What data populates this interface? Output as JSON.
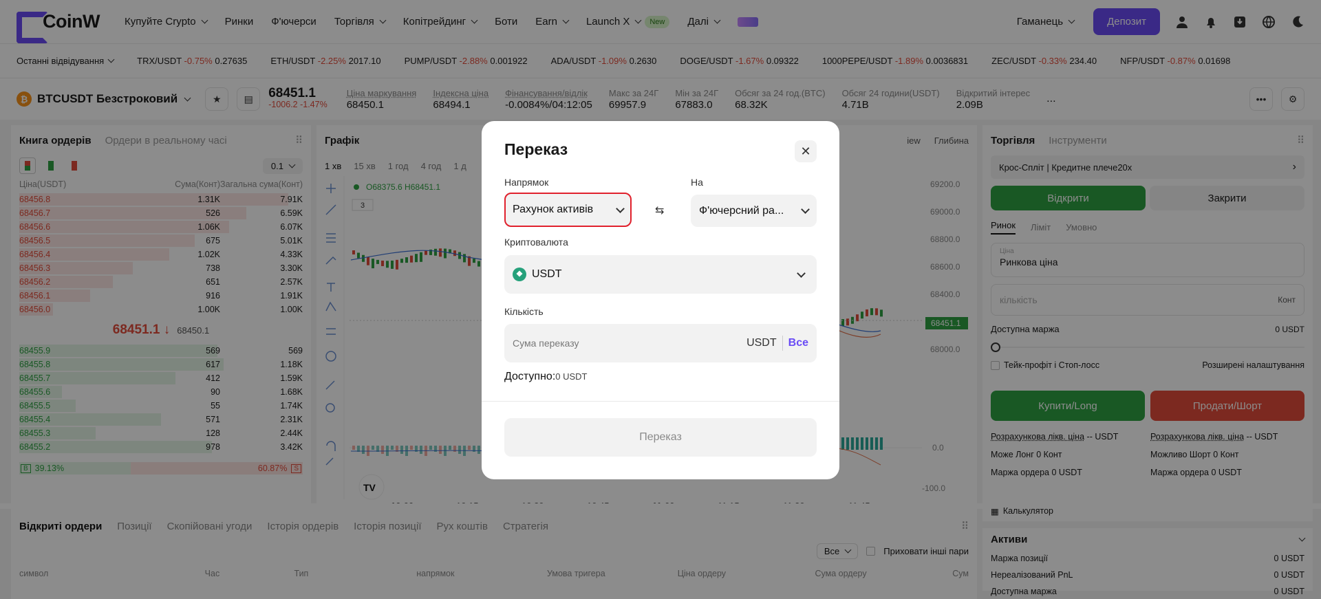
{
  "nav": {
    "logo": "CoinW",
    "items": [
      {
        "label": "Купуйте Crypto",
        "dropdown": true
      },
      {
        "label": "Ринки"
      },
      {
        "label": "Ф'ючерси"
      },
      {
        "label": "Торгівля",
        "dropdown": true
      },
      {
        "label": "Копітрейдинг",
        "dropdown": true
      },
      {
        "label": "Боти"
      },
      {
        "label": "Earn",
        "dropdown": true
      },
      {
        "label": "Launch X",
        "dropdown": true
      }
    ],
    "new_badge": "New",
    "more": "Далі",
    "wallet": "Гаманець",
    "deposit": "Депозит"
  },
  "ticker": {
    "recent": "Останні відвідування",
    "items": [
      {
        "pair": "TRX/USDT",
        "chg": "-0.75%",
        "price": "0.27635"
      },
      {
        "pair": "ETH/USDT",
        "chg": "-2.25%",
        "price": "2017.10"
      },
      {
        "pair": "PUMP/USDT",
        "chg": "-2.88%",
        "price": "0.001922"
      },
      {
        "pair": "ADA/USDT",
        "chg": "-1.09%",
        "price": "0.2630"
      },
      {
        "pair": "DOGE/USDT",
        "chg": "-1.67%",
        "price": "0.09322"
      },
      {
        "pair": "1000PEPE/USDT",
        "chg": "-1.89%",
        "price": "0.0036831"
      },
      {
        "pair": "ZEC/USDT",
        "chg": "-0.33%",
        "price": "234.40"
      },
      {
        "pair": "NFP/USDT",
        "chg": "-0.87%",
        "price": "0.01698"
      }
    ]
  },
  "symbol": {
    "coin": "₿",
    "name": "BTCUSDT Безстроковий",
    "price": "68451.1",
    "change": "-1006.2 -1.47%",
    "stats": [
      {
        "k": "Ціна маркування",
        "v": "68450.1"
      },
      {
        "k": "Індексна ціна",
        "v": "68494.1"
      },
      {
        "k": "Фінансування/відлік",
        "v": "-0.0084%/04:12:05"
      },
      {
        "k": "Макс за 24Г",
        "v": "69957.9"
      },
      {
        "k": "Мін за 24Г",
        "v": "67883.0"
      },
      {
        "k": "Обсяг за 24 год.(BTC)",
        "v": "68.32K"
      },
      {
        "k": "Обсяг 24 години(USDT)",
        "v": "4.71B"
      },
      {
        "k": "Відкритий інтерес",
        "v": "2.09B"
      }
    ],
    "more": "..."
  },
  "orderbook": {
    "tab_active": "Книга ордерів",
    "tab_other": "Ордери в реальному часі",
    "precision": "0.1",
    "cols": [
      "Ціна(USDT)",
      "Сума(Конт)",
      "Загальна сума(Конт)"
    ],
    "asks": [
      [
        "68456.8",
        "1.31K",
        "7.91K",
        0.95
      ],
      [
        "68456.7",
        "526",
        "6.59K",
        0.8
      ],
      [
        "68456.6",
        "1.06K",
        "6.07K",
        0.74
      ],
      [
        "68456.5",
        "675",
        "5.01K",
        0.62
      ],
      [
        "68456.4",
        "1.02K",
        "4.33K",
        0.53
      ],
      [
        "68456.3",
        "738",
        "3.30K",
        0.4
      ],
      [
        "68456.2",
        "651",
        "2.57K",
        0.33
      ],
      [
        "68456.1",
        "916",
        "1.91K",
        0.25
      ],
      [
        "68456.0",
        "1.00K",
        "1.00K",
        0.12
      ]
    ],
    "mid": "68451.1 ↓",
    "mid_sub": "68450.1",
    "bids": [
      [
        "68455.9",
        "569",
        "569",
        0.7
      ],
      [
        "68455.8",
        "617",
        "1.18K",
        0.72
      ],
      [
        "68455.7",
        "412",
        "1.59K",
        0.55
      ],
      [
        "68455.6",
        "90",
        "1.68K",
        0.15
      ],
      [
        "68455.5",
        "55",
        "1.74K",
        0.2
      ],
      [
        "68455.4",
        "571",
        "2.31K",
        0.5
      ],
      [
        "68455.3",
        "128",
        "2.44K",
        0.27
      ],
      [
        "68455.2",
        "978",
        "3.42K",
        0.68
      ]
    ],
    "buy_pct": "39.13%",
    "sell_pct": "60.87%",
    "b": "B",
    "s": "S"
  },
  "chart": {
    "title": "Графік",
    "intervals": [
      "1 хв",
      "15 хв",
      "1 год",
      "4 год",
      "1 д"
    ],
    "view": "iew",
    "depth": "Глибина",
    "ohlc": "O68375.6 H68451.1",
    "collapsed": "3",
    "prices": [
      "69200.0",
      "69000.0",
      "68800.0",
      "68600.0",
      "68400.0",
      "68200.0",
      "68000.0"
    ],
    "last": "68451.1",
    "times": [
      "10:00",
      "10:15",
      "10:30",
      "10:45",
      "11:00",
      "11:15",
      "11:30",
      "11:45"
    ],
    "ind": [
      "0.0",
      "-100.0"
    ]
  },
  "trade": {
    "tab_active": "Торгівля",
    "tab_other": "Інструменти",
    "mode": "Крос-Спліт | Кредитне плече20x",
    "open": "Відкрити",
    "close": "Закрити",
    "types": [
      "Ринок",
      "Ліміт",
      "Умовно"
    ],
    "price_lab": "Ціна",
    "price_val": "Ринкова ціна",
    "qty": "кількість",
    "unit": "Конт",
    "margin": "Доступна маржа",
    "margin_val": "0 USDT",
    "tpsl": "Тейк-профіт і Стоп-лосс",
    "adv": "Розширені налаштування",
    "buy": "Купити/Long",
    "sell": "Продати/Шорт",
    "liq": "Розрахункова лікв. ціна",
    "liq_val": "-- USDT",
    "can_long": "Може Лонг 0 Конт",
    "can_short": "Можливо Шорт 0 Конт",
    "order_margin": "Маржа ордера 0 USDT",
    "calc": "Калькулятор",
    "assets": "Активи",
    "asset_rows": [
      {
        "k": "Маржа позиції",
        "v": "0 USDT"
      },
      {
        "k": "Нереалізований PnL",
        "v": "0 USDT"
      },
      {
        "k": "Доступна маржа",
        "v": "0 USDT"
      }
    ],
    "colors": {
      "buy": "#2ea043",
      "sell": "#e24c3b"
    }
  },
  "orders": {
    "tabs": [
      "Відкриті ордери",
      "Позиції",
      "Скопійовані угоди",
      "Історія ордерів",
      "Історія позиції",
      "Рух коштів",
      "Стратегія"
    ],
    "filter": "Все",
    "hide": "Приховати інші пари",
    "cols": [
      "символ",
      "Час",
      "Тип",
      "напрямок",
      "Умова тригера",
      "Ціна ордеру",
      "Сума ордеру",
      "Сум"
    ]
  },
  "modal": {
    "title": "Переказ",
    "from_label": "Напрямок",
    "from_value": "Рахунок активів",
    "to_label": "На",
    "to_value": "Ф'ючерсний ра...",
    "crypto_label": "Криптовалюта",
    "crypto_value": "USDT",
    "amount_label": "Кількість",
    "amount_placeholder": "Сума переказу",
    "amount_unit": "USDT",
    "all": "Все",
    "avail_label": "Доступно:",
    "avail_value": "0 USDT",
    "submit": "Переказ",
    "accent": "#6a4cf5",
    "highlight": "#e0202c"
  }
}
